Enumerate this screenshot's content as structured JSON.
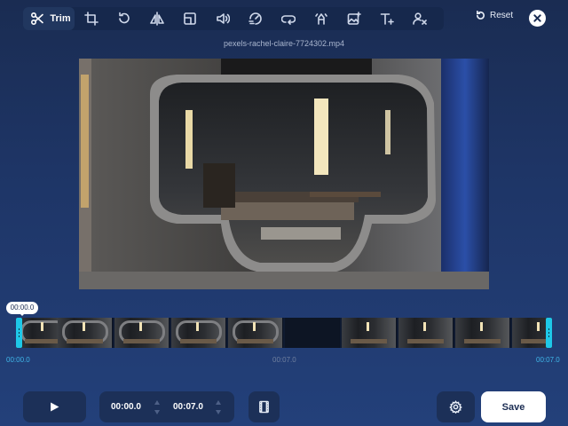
{
  "toolbar": {
    "active_label": "Trim",
    "tools": [
      {
        "icon": "scissors-icon",
        "label": "Trim"
      },
      {
        "icon": "crop-icon"
      },
      {
        "icon": "rotate-icon"
      },
      {
        "icon": "flip-icon"
      },
      {
        "icon": "layout-icon"
      },
      {
        "icon": "volume-icon"
      },
      {
        "icon": "speed-icon"
      },
      {
        "icon": "loop-icon"
      },
      {
        "icon": "stabilize-icon"
      },
      {
        "icon": "add-image-icon"
      },
      {
        "icon": "add-text-icon"
      },
      {
        "icon": "remove-person-icon"
      }
    ],
    "reset_label": "Reset"
  },
  "file": {
    "name": "pexels-rachel-claire-7724302.mp4"
  },
  "timeline": {
    "current_time": "00:00.0",
    "start_label": "00:00.0",
    "mid_label": "00:07.0",
    "end_label": "00:07.0"
  },
  "controls": {
    "start_time": "00:00.0",
    "end_time": "00:07.0",
    "save_label": "Save"
  },
  "colors": {
    "accent": "#1ec8e8",
    "background": "#1e3566",
    "time_label": "#3fb6e8"
  }
}
